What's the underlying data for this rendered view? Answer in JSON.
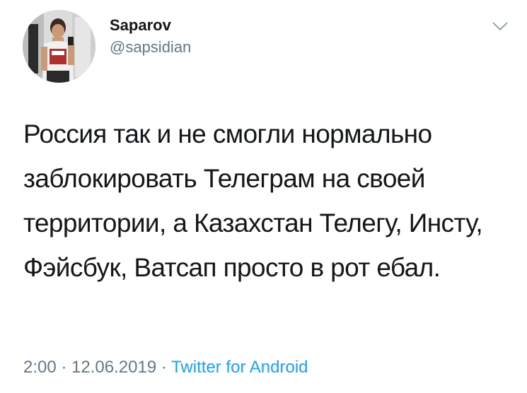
{
  "author": {
    "display_name": "Saparov",
    "handle": "@sapsidian"
  },
  "menu": {
    "icon": "chevron-down-icon"
  },
  "tweet": {
    "text": "Россия так и не смогли нормально заблокировать Телеграм на своей территории, а Казахстан Телегу, Инсту, Фэйсбук, Ватсап просто в рот ебал."
  },
  "meta": {
    "time": "2:00",
    "separator": " · ",
    "date": "12.06.2019",
    "source": "Twitter for Android"
  },
  "colors": {
    "text": "#14171a",
    "secondary": "#657786",
    "link": "#1da1f2"
  }
}
